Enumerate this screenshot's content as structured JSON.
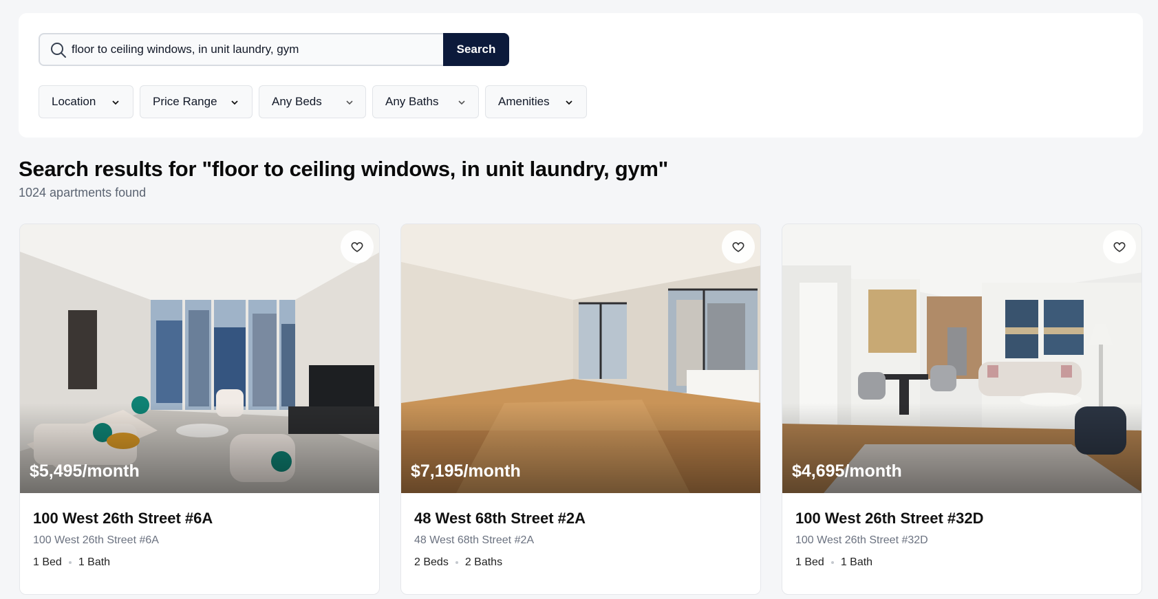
{
  "search": {
    "value": "floor to ceiling windows, in unit laundry, gym",
    "button_label": "Search"
  },
  "filters": [
    {
      "label": "Location"
    },
    {
      "label": "Price Range"
    },
    {
      "label": "Any Beds"
    },
    {
      "label": "Any Baths"
    },
    {
      "label": "Amenities"
    }
  ],
  "results": {
    "title": "Search results for \"floor to ceiling windows, in unit laundry, gym\"",
    "count": "1024 apartments found"
  },
  "listings": [
    {
      "price": "$5,495/month",
      "title": "100 West 26th Street #6A",
      "address": "100 West 26th Street #6A",
      "beds": "1 Bed",
      "baths": "1 Bath"
    },
    {
      "price": "$7,195/month",
      "title": "48 West 68th Street #2A",
      "address": "48 West 68th Street #2A",
      "beds": "2 Beds",
      "baths": "2 Baths"
    },
    {
      "price": "$4,695/month",
      "title": "100 West 26th Street #32D",
      "address": "100 West 26th Street #32D",
      "beds": "1 Bed",
      "baths": "1 Bath"
    }
  ],
  "colors": {
    "accent": "#0c1a3b",
    "background": "#f5f6f8",
    "muted_text": "#6b7280"
  },
  "icons": {
    "search": "search-icon",
    "dropdown": "chevron-down-icon",
    "favorite": "heart-icon"
  }
}
